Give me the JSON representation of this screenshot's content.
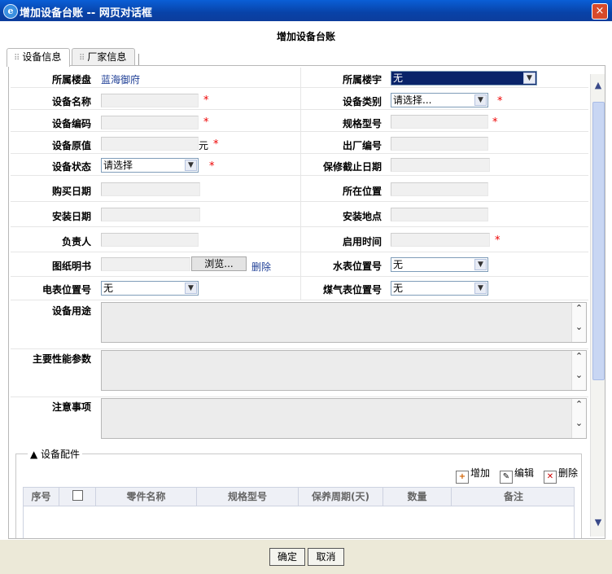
{
  "window": {
    "title": "增加设备台账 -- 网页对话框",
    "close": "×"
  },
  "heading": "增加设备台账",
  "tabs": [
    {
      "label": "设备信息"
    },
    {
      "label": "厂家信息"
    }
  ],
  "form": {
    "estate": {
      "label": "所属楼盘",
      "value": "蓝海御府"
    },
    "building": {
      "label": "所属楼宇",
      "value": "无"
    },
    "name": {
      "label": "设备名称"
    },
    "category": {
      "label": "设备类别",
      "value": "请选择..."
    },
    "code": {
      "label": "设备编码"
    },
    "spec": {
      "label": "规格型号"
    },
    "orig_value": {
      "label": "设备原值",
      "unit": "元"
    },
    "factory_no": {
      "label": "出厂编号"
    },
    "status": {
      "label": "设备状态",
      "value": "请选择"
    },
    "warranty_end": {
      "label": "保修截止日期"
    },
    "purchase_date": {
      "label": "购买日期"
    },
    "location": {
      "label": "所在位置"
    },
    "install_date": {
      "label": "安装日期"
    },
    "install_place": {
      "label": "安装地点"
    },
    "owner": {
      "label": "负责人"
    },
    "enable_time": {
      "label": "启用时间"
    },
    "drawing": {
      "label": "图纸明书",
      "browse": "浏览...",
      "delete": "删除"
    },
    "water_meter": {
      "label": "水表位置号",
      "value": "无"
    },
    "power_meter": {
      "label": "电表位置号",
      "value": "无"
    },
    "gas_meter": {
      "label": "煤气表位置号",
      "value": "无"
    },
    "usage": {
      "label": "设备用途"
    },
    "params": {
      "label": "主要性能参数"
    },
    "notes": {
      "label": "注意事项"
    },
    "required_mark": "*"
  },
  "parts": {
    "legend": "设备配件",
    "toolbar": {
      "add": "增加",
      "edit": "编辑",
      "delete": "删除"
    },
    "columns": [
      "序号",
      "",
      "零件名称",
      "规格型号",
      "保养周期(天)",
      "数量",
      "备注"
    ]
  },
  "buttons": {
    "ok": "确定",
    "cancel": "取消"
  }
}
